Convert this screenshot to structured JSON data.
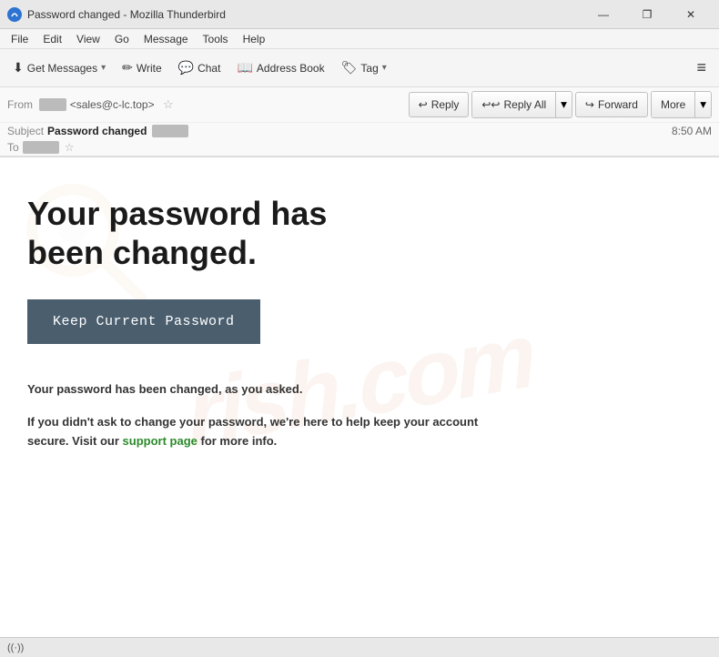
{
  "window": {
    "title": "Password changed - Mozilla Thunderbird",
    "icon": "T"
  },
  "titlebar": {
    "minimize_label": "—",
    "restore_label": "❐",
    "close_label": "✕"
  },
  "menubar": {
    "items": [
      {
        "label": "File",
        "id": "file"
      },
      {
        "label": "Edit",
        "id": "edit"
      },
      {
        "label": "View",
        "id": "view"
      },
      {
        "label": "Go",
        "id": "go"
      },
      {
        "label": "Message",
        "id": "message"
      },
      {
        "label": "Tools",
        "id": "tools"
      },
      {
        "label": "Help",
        "id": "help"
      }
    ]
  },
  "toolbar": {
    "get_messages_label": "Get Messages",
    "write_label": "Write",
    "chat_label": "Chat",
    "address_book_label": "Address Book",
    "tag_label": "Tag",
    "hamburger": "≡"
  },
  "email_header": {
    "from_label": "From",
    "from_blurred": "██████",
    "from_email": "<sales@c-lc.top>",
    "from_star": "☆",
    "reply_label": "Reply",
    "reply_all_label": "Reply All",
    "forward_label": "Forward",
    "more_label": "More",
    "subject_label": "Subject",
    "subject_value": "Password changed",
    "subject_blurred": "███████████",
    "timestamp": "8:50 AM",
    "to_label": "To",
    "to_blurred": "█████████"
  },
  "email_body": {
    "headline_line1": "Your password has",
    "headline_line2": "been changed.",
    "keep_btn_label": "Keep Current Password",
    "watermark_text": "rish.com",
    "para1": "Your password has been changed, as you asked.",
    "para2_before": "If you didn't ask to change your password, we're here to help keep your account secure. Visit our ",
    "para2_link": "support page",
    "para2_after": " for more info."
  },
  "statusbar": {
    "icon": "((·))"
  }
}
